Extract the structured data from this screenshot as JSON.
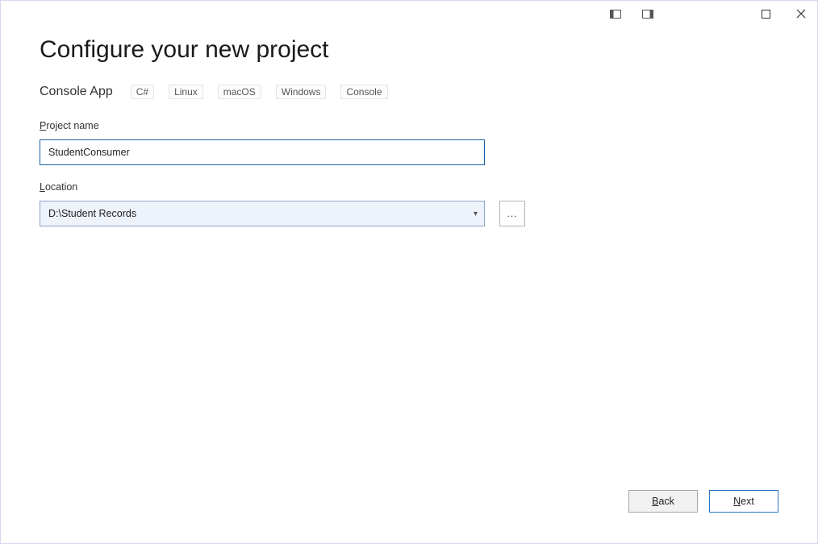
{
  "window": {
    "title": "Configure your new project"
  },
  "subtitle": {
    "template": "Console App",
    "tags": [
      "C#",
      "Linux",
      "macOS",
      "Windows",
      "Console"
    ]
  },
  "fields": {
    "project_name": {
      "label_pre": "",
      "label_ul": "P",
      "label_post": "roject name",
      "value": "StudentConsumer"
    },
    "location": {
      "label_pre": "",
      "label_ul": "L",
      "label_post": "ocation",
      "value": "D:\\Student Records",
      "browse_label": "..."
    }
  },
  "footer": {
    "back_pre": "",
    "back_ul": "B",
    "back_post": "ack",
    "next_pre": "",
    "next_ul": "N",
    "next_post": "ext"
  }
}
